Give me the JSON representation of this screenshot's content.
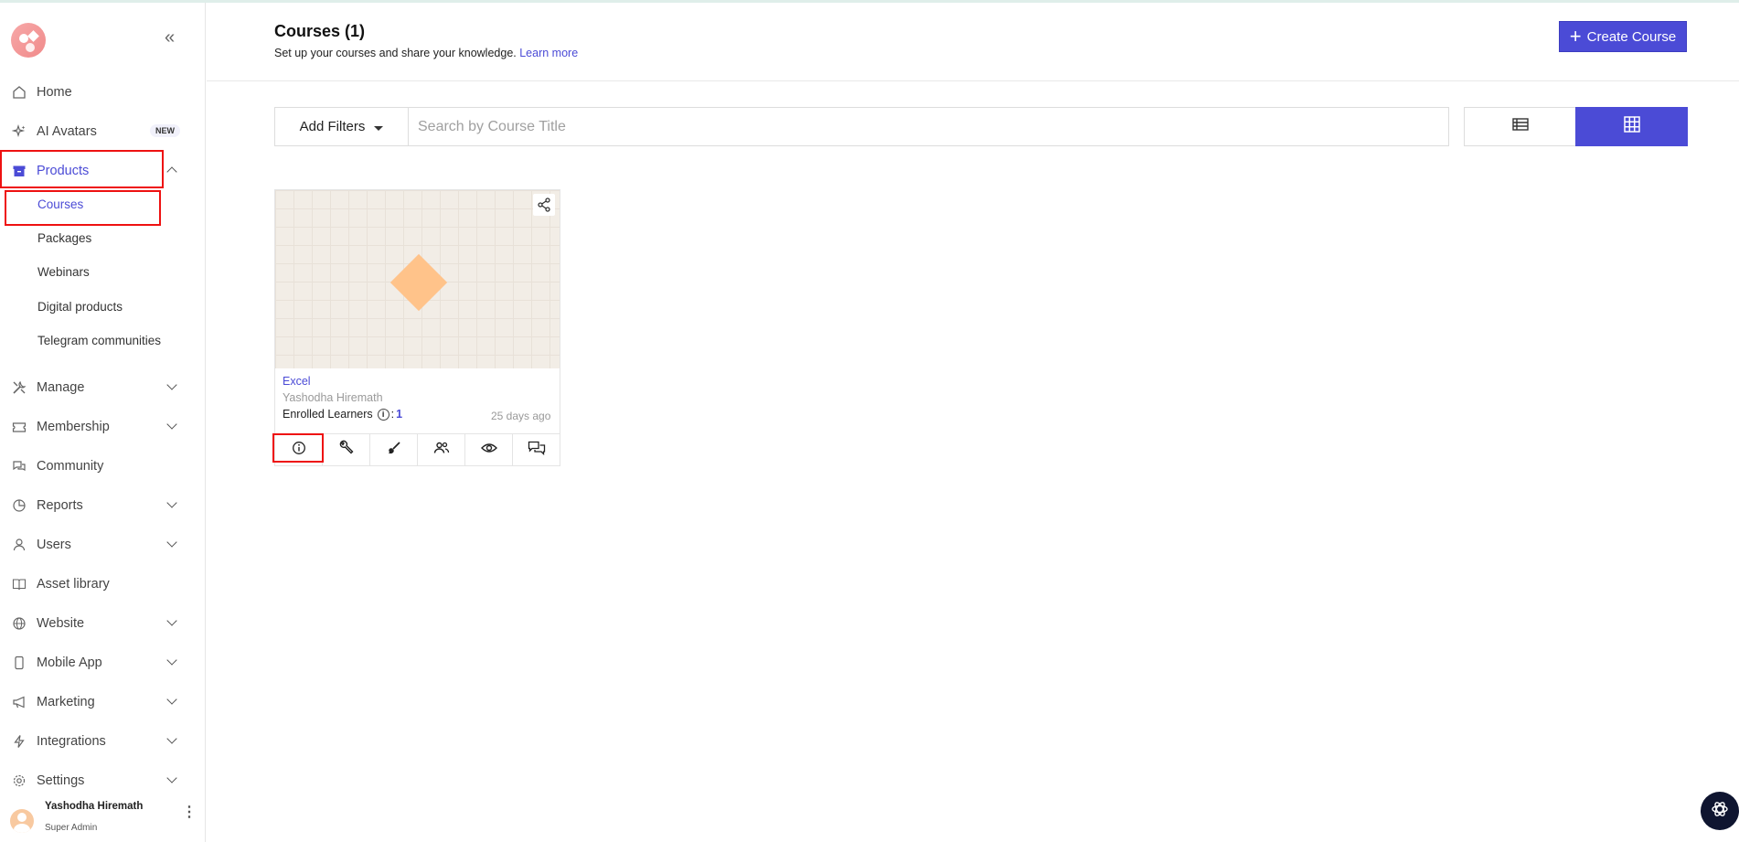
{
  "sidebar": {
    "items": {
      "home": {
        "label": "Home"
      },
      "ai_avatars": {
        "label": "AI Avatars",
        "badge": "NEW"
      },
      "products": {
        "label": "Products"
      },
      "manage": {
        "label": "Manage"
      },
      "membership": {
        "label": "Membership"
      },
      "community": {
        "label": "Community"
      },
      "reports": {
        "label": "Reports"
      },
      "users": {
        "label": "Users"
      },
      "asset_library": {
        "label": "Asset library"
      },
      "website": {
        "label": "Website"
      },
      "mobile_app": {
        "label": "Mobile App"
      },
      "marketing": {
        "label": "Marketing"
      },
      "integrations": {
        "label": "Integrations"
      },
      "settings": {
        "label": "Settings"
      }
    },
    "products_sub": {
      "courses": "Courses",
      "packages": "Packages",
      "webinars": "Webinars",
      "digital_products": "Digital products",
      "telegram": "Telegram communities"
    },
    "user": {
      "name": "Yashodha Hiremath",
      "role": "Super Admin"
    }
  },
  "header": {
    "title": "Courses (1)",
    "subtitle": "Set up your courses and share your knowledge.",
    "learn_more": "Learn more",
    "create_button": "Create Course"
  },
  "filters": {
    "add_filters": "Add Filters",
    "search_placeholder": "Search by Course Title"
  },
  "courses": [
    {
      "title": "Excel",
      "author": "Yashodha Hiremath",
      "enrolled_label": "Enrolled Learners",
      "enrolled_count": "1",
      "date": "25 days ago"
    }
  ],
  "colors": {
    "accent": "#4b4bd6",
    "highlight": "#e11111",
    "thumb_shape": "#ffc38a"
  }
}
